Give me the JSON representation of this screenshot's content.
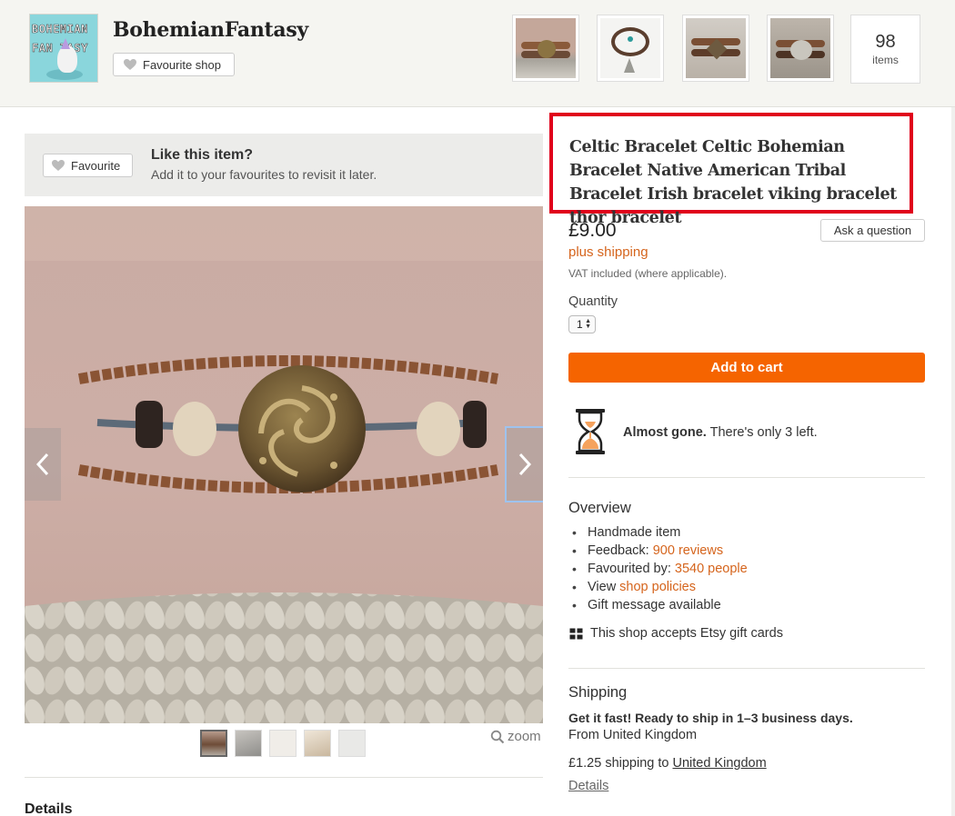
{
  "shop": {
    "logo_line1": "BOHEMIAN",
    "logo_line2": "FAN TASY",
    "name": "BohemianFantasy",
    "favourite_label": "Favourite shop",
    "items_count": "98",
    "items_label": "items",
    "thumbnails": [
      "bracelet-thumb-1",
      "bracelet-thumb-2",
      "bracelet-thumb-3",
      "bracelet-thumb-4"
    ]
  },
  "like_box": {
    "favourite_label": "Favourite",
    "title": "Like this item?",
    "subtitle": "Add it to your favourites to revisit it later."
  },
  "gallery": {
    "zoom_label": "zoom",
    "thumbnails_count": 5,
    "selected_thumbnail_index": 0
  },
  "listing": {
    "title": "Celtic Bracelet Celtic Bohemian Bracelet Native American Tribal Bracelet Irish bracelet viking bracelet thor bracelet",
    "price": "£9.00",
    "ask_label": "Ask a question",
    "plus_shipping": "plus shipping",
    "vat_note": "VAT included (where applicable).",
    "quantity_label": "Quantity",
    "quantity_value": "1",
    "add_to_cart": "Add to cart",
    "stock_bold": "Almost gone.",
    "stock_text": " There's only 3 left."
  },
  "overview": {
    "heading": "Overview",
    "handmade": "Handmade item",
    "feedback_label": "Feedback:",
    "feedback_link": "900 reviews",
    "favourited_label": "Favourited by:",
    "favourited_link": "3540 people",
    "view_label": "View",
    "policies_link": "shop policies",
    "gift_message": "Gift message available",
    "gift_cards": "This shop accepts Etsy gift cards"
  },
  "shipping": {
    "heading": "Shipping",
    "fast": "Get it fast! Ready to ship in 1–3 business days.",
    "from": "From United Kingdom",
    "cost_prefix": "£1.25 shipping to ",
    "cost_country": "United Kingdom",
    "details_link": "Details"
  },
  "details": {
    "heading": "Details"
  },
  "colors": {
    "accent_orange": "#f56400",
    "link_orange": "#d5641c",
    "highlight_red": "#e0001b"
  }
}
